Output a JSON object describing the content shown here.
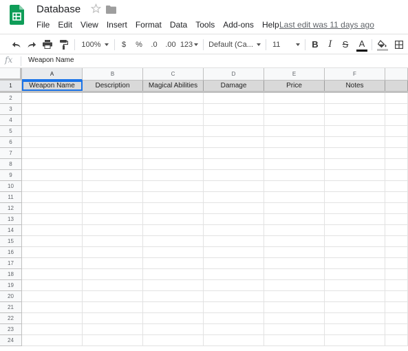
{
  "header": {
    "title": "Database",
    "last_edit": "Last edit was 11 days ago"
  },
  "menu": [
    "File",
    "Edit",
    "View",
    "Insert",
    "Format",
    "Data",
    "Tools",
    "Add-ons",
    "Help"
  ],
  "toolbar": {
    "zoom": "100%",
    "currency": "$",
    "percent": "%",
    "decrease_decimal": ".0",
    "increase_decimal": ".00",
    "more_formats": "123",
    "font": "Default (Ca...",
    "font_size": "11",
    "bold": "B",
    "italic": "I",
    "strikethrough": "S",
    "text_color": "A",
    "text_color_bar": "#000000",
    "fill_color_bar": "#bdbdbd"
  },
  "formula_bar": {
    "fx": "fx",
    "value": "Weapon Name"
  },
  "sheet": {
    "columns": [
      "A",
      "B",
      "C",
      "D",
      "E",
      "F"
    ],
    "header_row": [
      "Weapon Name",
      "Description",
      "Magical Abilities",
      "Damage",
      "Price",
      "Notes"
    ],
    "rows": [
      "1",
      "2",
      "3",
      "4",
      "5",
      "6",
      "7",
      "8",
      "9",
      "10",
      "11",
      "12",
      "13",
      "14",
      "15",
      "16",
      "17",
      "18",
      "19",
      "20",
      "21",
      "22",
      "23",
      "24"
    ]
  },
  "colors": {
    "accent": "#1a73e8",
    "sheets_green": "#0f9d58",
    "header_fill": "#d9d9d9"
  },
  "icons": {
    "app": "google-sheets-logo",
    "star": "star-outline-icon",
    "folder": "folder-icon"
  }
}
